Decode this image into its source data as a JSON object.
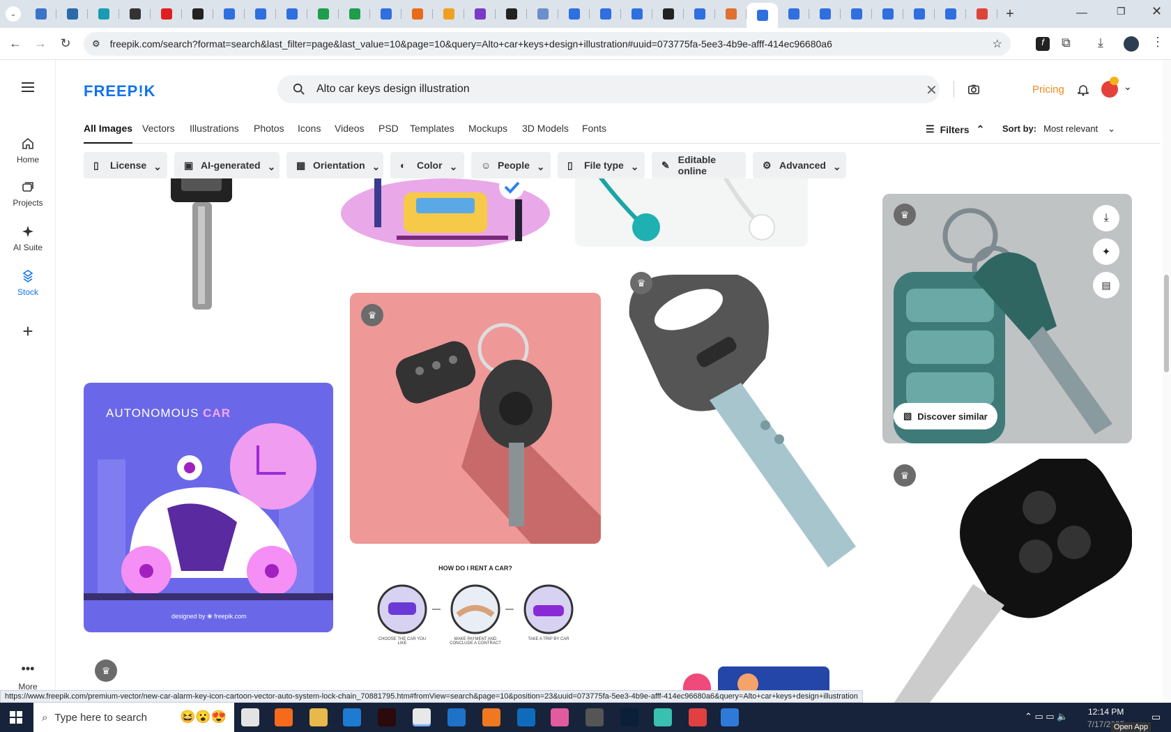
{
  "browser": {
    "url": "freepik.com/search?format=search&last_filter=page&last_value=10&page=10&query=Alto+car+keys+design+illustration#uuid=073775fa-5ee3-4b9e-afff-414ec96680a6",
    "status_url": "https://www.freepik.com/premium-vector/new-car-alarm-key-icon-cartoon-vector-auto-system-lock-chain_70881795.htm#fromView=search&page=10&position=23&uuid=073775fa-5ee3-4b9e-afff-414ec96680a6&query=Alto+car+keys+design+illustration",
    "tab_colors": [
      "#3a74c9",
      "#2a6aa8",
      "#1a9bb4",
      "#333",
      "#e02020",
      "#222",
      "#2f6fdf",
      "#2f6fdf",
      "#2f6fdf",
      "#1e9e4b",
      "#1e9e4b",
      "#2f6fdf",
      "#e86a1b",
      "#f0a020",
      "#7a3ac7",
      "#222",
      "#6a8fc9",
      "#2f6fdf",
      "#2f6fdf",
      "#2f6fdf",
      "#222",
      "#2f6fdf",
      "#e07030",
      "#2f6fdf",
      "#2f6fdf",
      "#2f6fdf",
      "#2f6fdf",
      "#2f6fdf",
      "#2f6fdf",
      "#2f6fdf",
      "#db4437"
    ]
  },
  "site": {
    "logo": "FREEP!K",
    "search_query": "Alto car keys design illustration",
    "pricing": "Pricing",
    "sidebar": {
      "home": "Home",
      "projects": "Projects",
      "ai_suite": "AI Suite",
      "stock": "Stock",
      "more": "More"
    },
    "tabs": [
      "All Images",
      "Vectors",
      "Illustrations",
      "Photos",
      "Icons",
      "Videos",
      "PSD",
      "Templates",
      "Mockups",
      "3D Models",
      "Fonts"
    ],
    "filters_label": "Filters",
    "sort_label": "Sort by:",
    "sort_value": "Most relevant",
    "chips": [
      "License",
      "AI-generated",
      "Orientation",
      "Color",
      "People",
      "File type",
      "Editable online",
      "Advanced"
    ]
  },
  "results": {
    "autonomous_title_a": "AUTONOMOUS",
    "autonomous_title_b": "CAR",
    "autonomous_credit": "designed by ❀ freepik.com",
    "rent_title": "HOW DO I RENT A CAR?",
    "rent_steps": [
      "CHOOSE THE CAR YOU LIKE",
      "MAKE PAYMENT AND CONCLUDE A CONTRACT",
      "TAKE A TRIP BY CAR"
    ],
    "discover_similar": "Discover similar"
  },
  "taskbar": {
    "search_placeholder": "Type here to search",
    "time": "12:14 PM",
    "date": "7/17/2025",
    "open_app": "Open App"
  }
}
